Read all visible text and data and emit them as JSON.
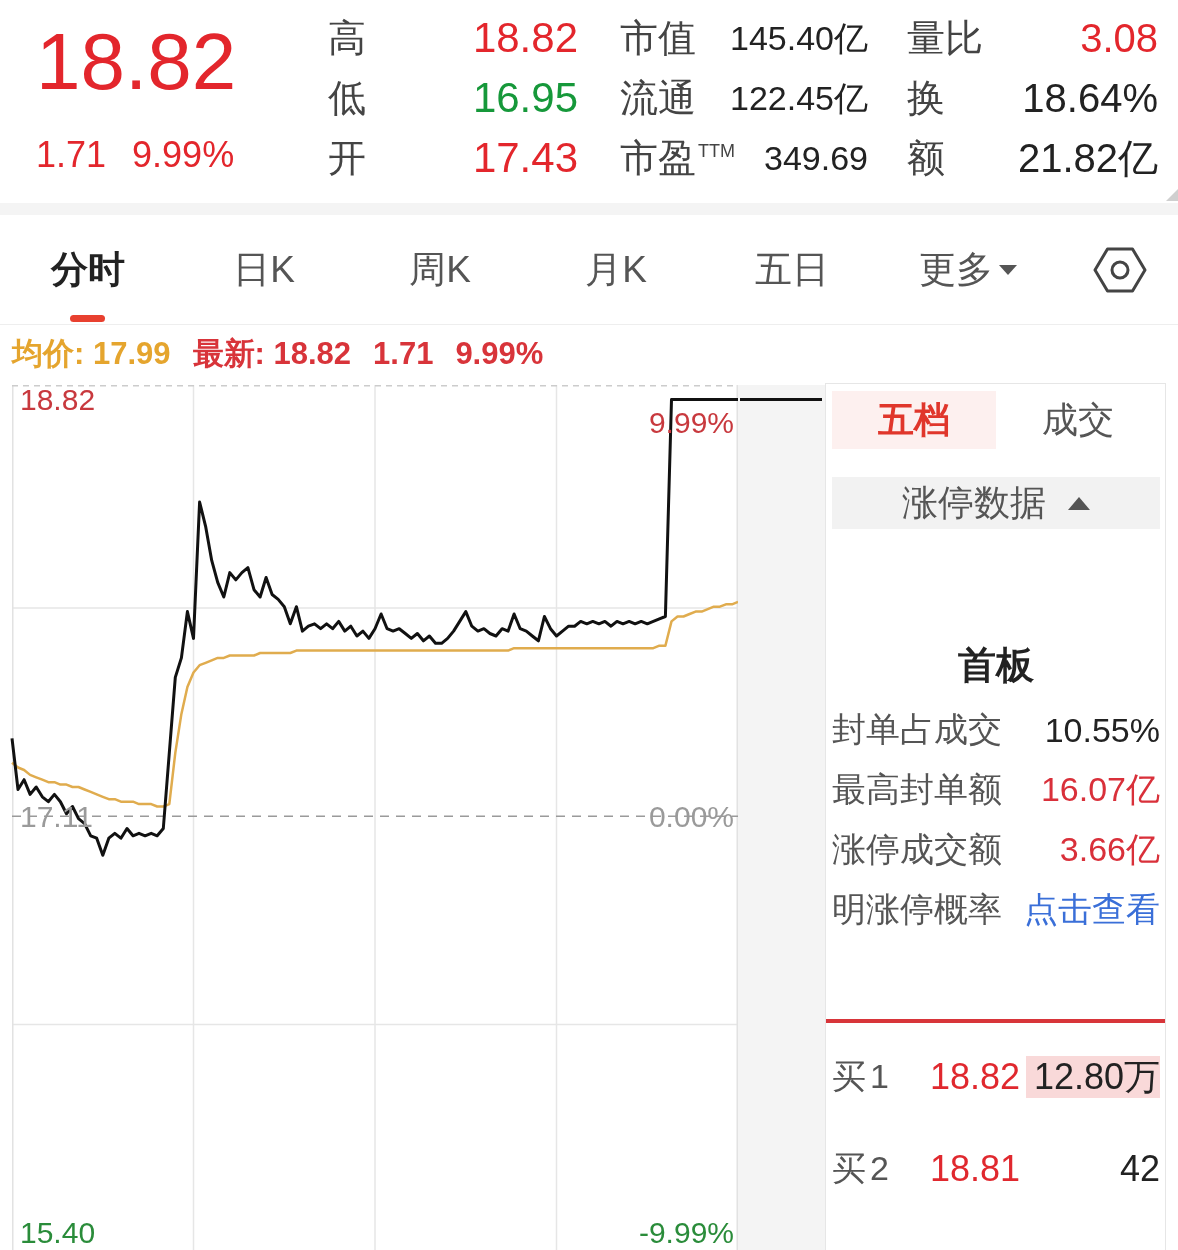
{
  "quote": {
    "price": "18.82",
    "change": "1.71",
    "change_pct": "9.99%",
    "rising": true
  },
  "stats": [
    {
      "label": "高",
      "value": "18.82",
      "color": "#e3262c"
    },
    {
      "label": "市值",
      "value": "145.40亿",
      "color": "#222222"
    },
    {
      "label": "量比",
      "value": "3.08",
      "color": "#e3262c"
    },
    {
      "label": "低",
      "value": "16.95",
      "color": "#16983a"
    },
    {
      "label": "流通",
      "value": "122.45亿",
      "color": "#222222"
    },
    {
      "label": "换",
      "value": "18.64%",
      "color": "#222222"
    },
    {
      "label": "开",
      "value": "17.43",
      "color": "#e3262c"
    },
    {
      "label": "市盈$^{TTM}$",
      "value": "349.69",
      "color": "#222222"
    },
    {
      "label": "额",
      "value": "21.82亿",
      "color": "#222222"
    }
  ],
  "tabs": [
    {
      "label": "分时",
      "selected": true,
      "kind": "view"
    },
    {
      "label": "日K",
      "selected": false,
      "kind": "view"
    },
    {
      "label": "周K",
      "selected": false,
      "kind": "view"
    },
    {
      "label": "月K",
      "selected": false,
      "kind": "view"
    },
    {
      "label": "五日",
      "selected": false,
      "kind": "view"
    },
    {
      "label": "更多",
      "selected": false,
      "kind": "menu"
    }
  ],
  "legend": [
    {
      "kind": "average",
      "text": "均价: 17.99"
    },
    {
      "kind": "latest",
      "text": "最新: 18.82"
    },
    {
      "kind": "latest",
      "text": "1.71"
    },
    {
      "kind": "latest",
      "text": "9.99%"
    }
  ],
  "chart": {
    "right_axis_labels": [
      "9.99%",
      "0.00%",
      "-9.99%"
    ],
    "chart_data": {
      "type": "line",
      "grid": true,
      "ylim": [
        15.33,
        18.88
      ],
      "yticks": [
        {
          "value": 15.4,
          "label": "15.40"
        },
        {
          "value": 17.11,
          "label": "17.11"
        },
        {
          "value": 18.82,
          "label": "18.82"
        }
      ],
      "series": [
        {
          "color": "#111111",
          "values": [
            17.43,
            17.22,
            17.26,
            17.2,
            17.23,
            17.19,
            17.17,
            17.2,
            17.17,
            17.12,
            17.15,
            17.1,
            17.08,
            17.03,
            17.02,
            16.95,
            17.02,
            17.04,
            17.02,
            17.06,
            17.03,
            17.04,
            17.03,
            17.04,
            17.03,
            17.06,
            17.37,
            17.68,
            17.76,
            17.95,
            17.84,
            18.4,
            18.3,
            18.16,
            18.07,
            18.01,
            18.11,
            18.08,
            18.11,
            18.13,
            18.04,
            18.01,
            18.09,
            18.02,
            18.0,
            17.97,
            17.9,
            17.97,
            17.87,
            17.89,
            17.9,
            17.88,
            17.9,
            17.88,
            17.91,
            17.87,
            17.89,
            17.85,
            17.87,
            17.84,
            17.88,
            17.94,
            17.88,
            17.87,
            17.88,
            17.86,
            17.84,
            17.86,
            17.83,
            17.85,
            17.82,
            17.82,
            17.84,
            17.87,
            17.91,
            17.95,
            17.89,
            17.87,
            17.88,
            17.86,
            17.85,
            17.88,
            17.87,
            17.94,
            17.88,
            17.87,
            17.85,
            17.83,
            17.93,
            17.88,
            17.85,
            17.87,
            17.89,
            17.89,
            17.91,
            17.9,
            17.91,
            17.9,
            17.91,
            17.89,
            17.91,
            17.9,
            17.91,
            17.9,
            17.91,
            17.9,
            17.91,
            17.92,
            17.93,
            18.82,
            18.82,
            18.82,
            18.82,
            18.82,
            18.82,
            18.82,
            18.82,
            18.82,
            18.82,
            18.82,
            18.82
          ]
        },
        {
          "color": "#e0ac4e",
          "values": [
            17.33,
            17.31,
            17.3,
            17.28,
            17.27,
            17.26,
            17.25,
            17.25,
            17.24,
            17.24,
            17.23,
            17.23,
            17.22,
            17.21,
            17.2,
            17.19,
            17.18,
            17.18,
            17.17,
            17.17,
            17.17,
            17.16,
            17.16,
            17.16,
            17.15,
            17.15,
            17.16,
            17.37,
            17.53,
            17.64,
            17.7,
            17.73,
            17.74,
            17.75,
            17.76,
            17.76,
            17.77,
            17.77,
            17.77,
            17.77,
            17.77,
            17.78,
            17.78,
            17.78,
            17.78,
            17.78,
            17.78,
            17.79,
            17.79,
            17.79,
            17.79,
            17.79,
            17.79,
            17.79,
            17.79,
            17.79,
            17.79,
            17.79,
            17.79,
            17.79,
            17.79,
            17.79,
            17.79,
            17.79,
            17.79,
            17.79,
            17.79,
            17.79,
            17.79,
            17.79,
            17.79,
            17.79,
            17.79,
            17.79,
            17.79,
            17.79,
            17.79,
            17.79,
            17.79,
            17.79,
            17.79,
            17.79,
            17.79,
            17.8,
            17.8,
            17.8,
            17.8,
            17.8,
            17.8,
            17.8,
            17.8,
            17.8,
            17.8,
            17.8,
            17.8,
            17.8,
            17.8,
            17.8,
            17.8,
            17.8,
            17.8,
            17.8,
            17.8,
            17.8,
            17.8,
            17.8,
            17.8,
            17.81,
            17.81,
            17.91,
            17.93,
            17.93,
            17.94,
            17.95,
            17.95,
            17.96,
            17.97,
            17.97,
            17.98,
            17.98,
            17.99
          ]
        },
        {
          "color": "#9a9a9a",
          "line_style": "dashed",
          "values": [
            17.11,
            17.11,
            17.11,
            17.11,
            17.11,
            17.11,
            17.11,
            17.11,
            17.11,
            17.11,
            17.11,
            17.11,
            17.11,
            17.11,
            17.11,
            17.11,
            17.11,
            17.11,
            17.11,
            17.11,
            17.11,
            17.11,
            17.11,
            17.11,
            17.11,
            17.11,
            17.11,
            17.11,
            17.11,
            17.11,
            17.11,
            17.11,
            17.11,
            17.11,
            17.11,
            17.11,
            17.11,
            17.11,
            17.11,
            17.11,
            17.11,
            17.11,
            17.11,
            17.11,
            17.11,
            17.11,
            17.11,
            17.11,
            17.11,
            17.11,
            17.11,
            17.11,
            17.11,
            17.11,
            17.11,
            17.11,
            17.11,
            17.11,
            17.11,
            17.11,
            17.11,
            17.11,
            17.11,
            17.11,
            17.11,
            17.11,
            17.11,
            17.11,
            17.11,
            17.11,
            17.11,
            17.11,
            17.11,
            17.11,
            17.11,
            17.11,
            17.11,
            17.11,
            17.11,
            17.11,
            17.11,
            17.11,
            17.11,
            17.11,
            17.11,
            17.11,
            17.11,
            17.11,
            17.11,
            17.11,
            17.11,
            17.11,
            17.11,
            17.11,
            17.11,
            17.11,
            17.11,
            17.11,
            17.11,
            17.11,
            17.11,
            17.11,
            17.11,
            17.11,
            17.11,
            17.11,
            17.11,
            17.11,
            17.11,
            17.11,
            17.11,
            17.11,
            17.11,
            17.11,
            17.11,
            17.11,
            17.11,
            17.11,
            17.11,
            17.11,
            17.11
          ]
        }
      ]
    }
  },
  "side_panel": {
    "tabs": [
      {
        "label": "五档",
        "selected": true
      },
      {
        "label": "成交",
        "selected": false
      }
    ],
    "limit_up": {
      "title": "涨停数据",
      "expanded": true,
      "badge": "首板",
      "rows": [
        {
          "label": "封单占成交",
          "value": "10.55%",
          "kind": "plain"
        },
        {
          "label": "最高封单额",
          "value": "16.07亿",
          "kind": "highlight"
        },
        {
          "label": "涨停成交额",
          "value": "3.66亿",
          "kind": "highlight"
        },
        {
          "label": "明涨停概率",
          "value": "点击查看",
          "kind": "link"
        }
      ]
    },
    "order_book": [
      {
        "label": "买1",
        "price": "18.82",
        "volume": "12.80万",
        "level": 1
      },
      {
        "label": "买2",
        "price": "18.81",
        "volume": "42"
      }
    ]
  }
}
